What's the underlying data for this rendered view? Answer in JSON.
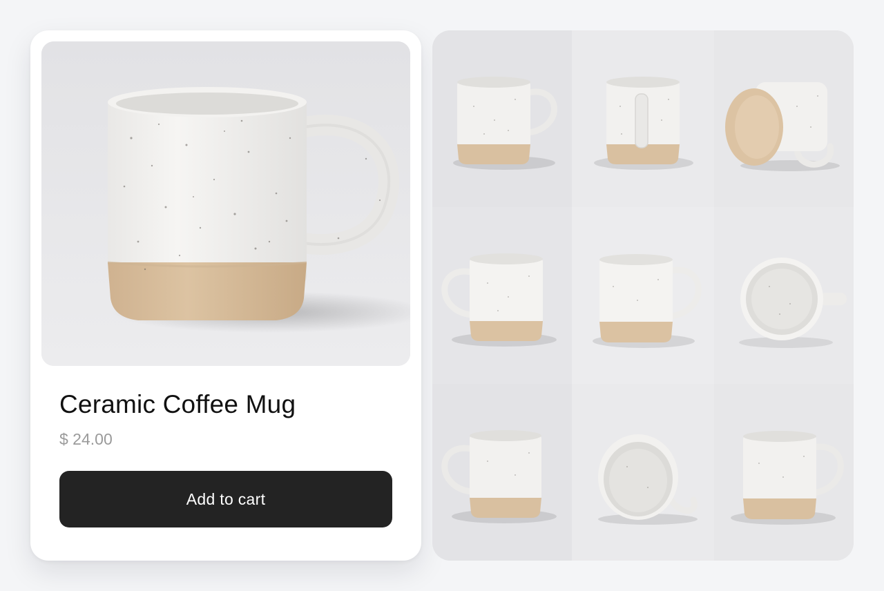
{
  "product": {
    "name": "Ceramic Coffee Mug",
    "price": "$ 24.00",
    "add_to_cart_label": "Add to cart",
    "hero_image": "mug-photo-front-right",
    "colors": {
      "page_bg": "#f4f5f7",
      "card_bg": "#ffffff",
      "photo_bg": "#e4e4e6",
      "glaze": "#f1f0ee",
      "clay": "#d8bf9d",
      "button_bg": "#232323",
      "price_text": "#9a9a9a"
    }
  },
  "gallery": {
    "thumbnails": [
      {
        "view": "mug-handle-right"
      },
      {
        "view": "mug-handle-back"
      },
      {
        "view": "mug-tipped-base"
      },
      {
        "view": "mug-handle-left"
      },
      {
        "view": "mug-handle-right"
      },
      {
        "view": "mug-top-down"
      },
      {
        "view": "mug-handle-left"
      },
      {
        "view": "mug-upside-down"
      },
      {
        "view": "mug-handle-right"
      }
    ]
  }
}
